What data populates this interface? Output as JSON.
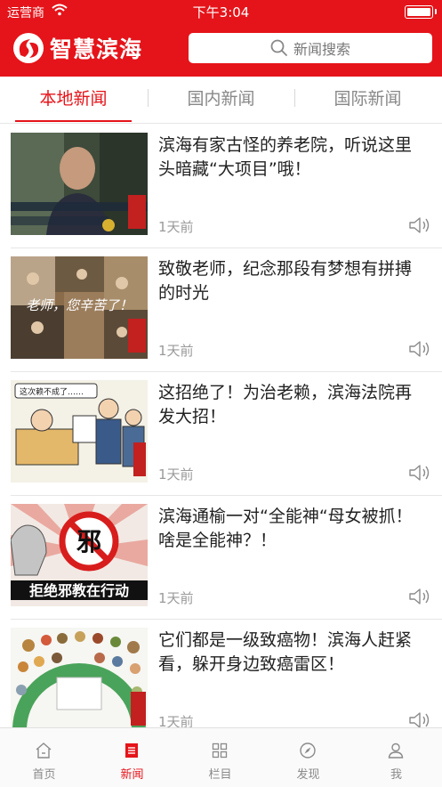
{
  "status_bar": {
    "carrier": "运营商",
    "time": "下午3:04"
  },
  "header": {
    "app_name": "智慧滨海",
    "search_placeholder": "新闻搜索"
  },
  "tabs": [
    {
      "label": "本地新闻",
      "active": true
    },
    {
      "label": "国内新闻",
      "active": false
    },
    {
      "label": "国际新闻",
      "active": false
    }
  ],
  "news": [
    {
      "title": "滨海有家古怪的养老院，听说这里头暗藏“大项目”哦！",
      "time": "1天前",
      "thumb_caption": ""
    },
    {
      "title": "致敬老师，纪念那段有梦想有拼搏的时光",
      "time": "1天前",
      "thumb_caption": "老师，您辛苦了！"
    },
    {
      "title": "这招绝了！为治老赖，滨海法院再发大招！",
      "time": "1天前",
      "thumb_caption": "这次赖不成了……"
    },
    {
      "title": "滨海通榆一对“全能神“母女被抓！啥是全能神？！",
      "time": "1天前",
      "thumb_caption": "拒绝邪教在行动"
    },
    {
      "title": "它们都是一级致癌物！滨海人赶紧看，躲开身边致癌雷区！",
      "time": "1天前",
      "thumb_caption": ""
    }
  ],
  "bottom_nav": [
    {
      "label": "首页",
      "icon": "home-icon",
      "active": false
    },
    {
      "label": "新闻",
      "icon": "news-icon",
      "active": true
    },
    {
      "label": "栏目",
      "icon": "grid-icon",
      "active": false
    },
    {
      "label": "发现",
      "icon": "compass-icon",
      "active": false
    },
    {
      "label": "我",
      "icon": "user-icon",
      "active": false
    }
  ],
  "colors": {
    "brand_red": "#e5141a",
    "inactive_gray": "#8a8a8a"
  }
}
